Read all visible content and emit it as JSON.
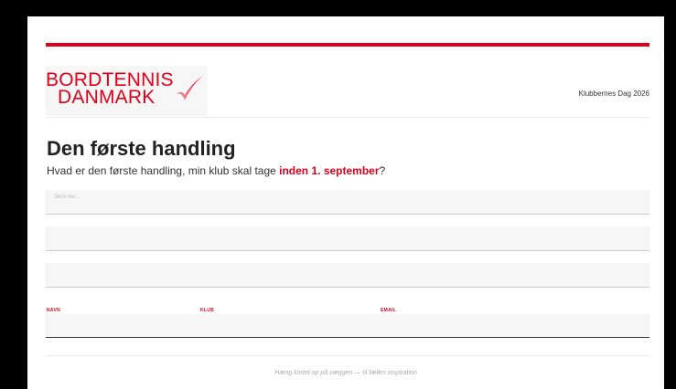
{
  "logo": {
    "line1": "BORDTENNIS",
    "line2": "DANMARK",
    "icon": "swoosh-icon",
    "brand_color": "#e1001a"
  },
  "header": {
    "event": "Klubbernes Dag 2026"
  },
  "card": {
    "title": "Den første handling",
    "question_prefix": "Hvad er den første handling, min klub skal tage ",
    "question_emphasis": "inden 1. september",
    "question_suffix": "?"
  },
  "fields": {
    "placeholder": "Skriv her..."
  },
  "labels": {
    "name": "NAVN",
    "club": "KLUB",
    "email": "EMAIL"
  },
  "footer": {
    "text": "Hæng kortet op på væggen — til fælles inspiration"
  },
  "colors": {
    "accent": "#e1001a",
    "field_bg": "#f6f6f6"
  }
}
